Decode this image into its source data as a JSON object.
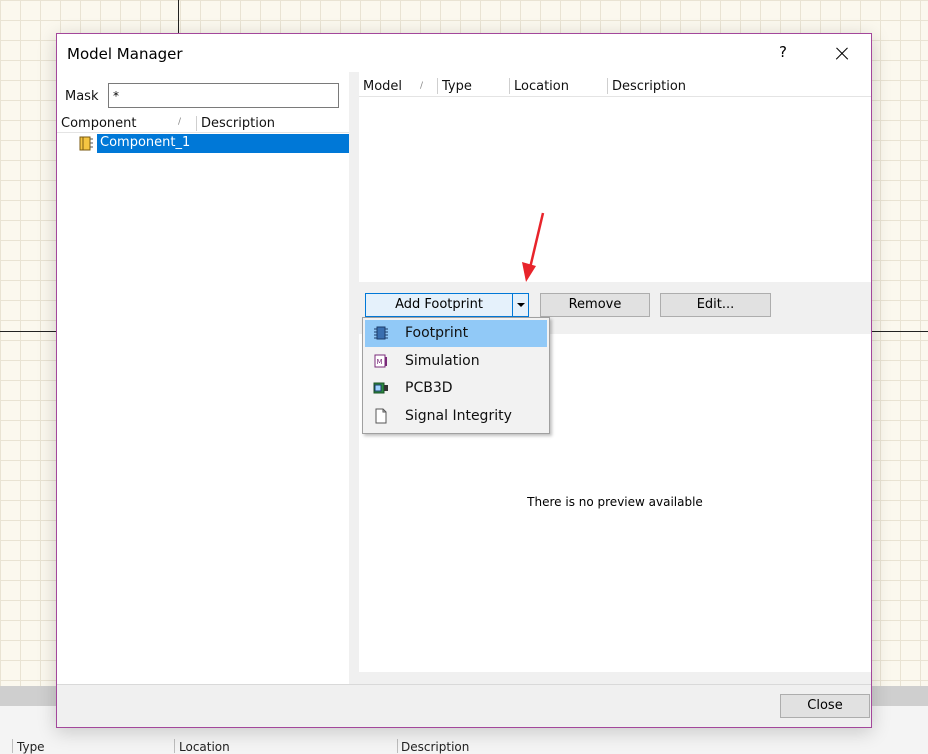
{
  "dialog": {
    "title": "Model Manager",
    "help_label": "?",
    "close_button": "Close"
  },
  "left_pane": {
    "mask_label": "Mask",
    "mask_value": "*",
    "columns": [
      "Component",
      "Description"
    ],
    "components": [
      {
        "name": "Component_1",
        "selected": true
      }
    ]
  },
  "right_pane": {
    "columns": [
      "Model",
      "Type",
      "Location",
      "Description"
    ],
    "buttons": {
      "add_footprint": "Add Footprint",
      "remove": "Remove",
      "edit": "Edit..."
    },
    "preview_text": "There is no preview available"
  },
  "add_menu": {
    "items": [
      {
        "label": "Footprint",
        "icon": "footprint-chip-icon",
        "highlighted": true
      },
      {
        "label": "Simulation",
        "icon": "simulation-model-icon",
        "highlighted": false
      },
      {
        "label": "PCB3D",
        "icon": "pcb3d-icon",
        "highlighted": false
      },
      {
        "label": "Signal Integrity",
        "icon": "document-icon",
        "highlighted": false
      }
    ]
  },
  "background_panel": {
    "columns": [
      "Type",
      "Location",
      "Description"
    ]
  },
  "colors": {
    "selection": "#0078d7",
    "menu_highlight": "#91c9f7",
    "dialog_border": "#a3479b",
    "annotation_arrow": "#e8242b"
  }
}
